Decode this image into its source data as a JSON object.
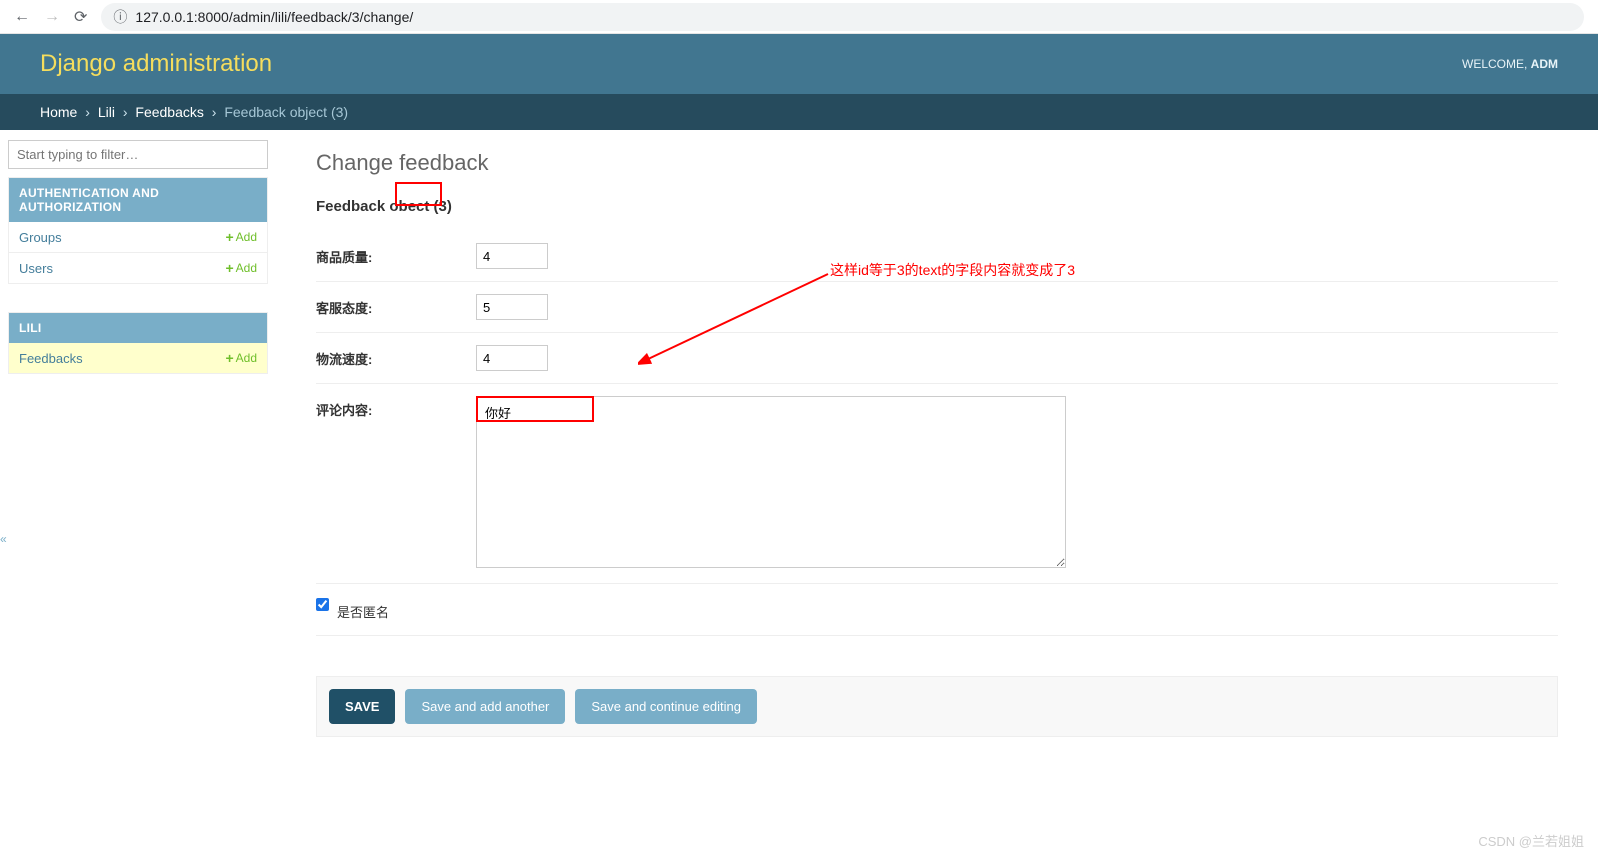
{
  "browser": {
    "url": "127.0.0.1:8000/admin/lili/feedback/3/change/"
  },
  "header": {
    "branding": "Django administration",
    "welcome": "WELCOME, ",
    "user": "ADM"
  },
  "breadcrumbs": {
    "home": "Home",
    "app": "Lili",
    "model": "Feedbacks",
    "current": "Feedback object (3)"
  },
  "sidebar": {
    "filter_placeholder": "Start typing to filter…",
    "auth_caption": "AUTHENTICATION AND AUTHORIZATION",
    "groups": "Groups",
    "users": "Users",
    "app_caption": "LILI",
    "feedbacks": "Feedbacks",
    "add": "Add"
  },
  "content": {
    "title": "Change feedback",
    "object_label_prefix": "Feedback ob",
    "object_label_suffix": "ect (3)",
    "fields": {
      "quality_label": "商品质量:",
      "quality_value": "4",
      "attitude_label": "客服态度:",
      "attitude_value": "5",
      "speed_label": "物流速度:",
      "speed_value": "4",
      "text_label": "评论内容:",
      "text_value": "你好",
      "anon_label": "是否匿名"
    },
    "buttons": {
      "save": "SAVE",
      "save_add": "Save and add another",
      "save_continue": "Save and continue editing"
    }
  },
  "annotation": "这样id等于3的text的字段内容就变成了3",
  "watermark": "CSDN @兰若姐姐"
}
